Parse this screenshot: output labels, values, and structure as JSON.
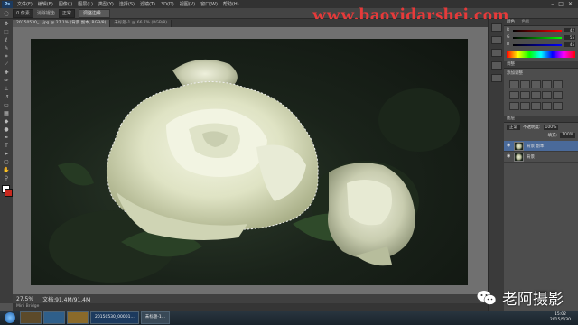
{
  "menubar": {
    "logo": "Ps",
    "items": [
      "文件(F)",
      "编辑(E)",
      "图像(I)",
      "图层(L)",
      "类型(Y)",
      "选择(S)",
      "滤镜(T)",
      "3D(D)",
      "视图(V)",
      "窗口(W)",
      "帮助(H)"
    ]
  },
  "options": {
    "feather_value": "0 像素",
    "anti_alias_label": "消除锯齿",
    "style_value": "正常",
    "refine_edge_label": "调整边缘..."
  },
  "watermark": "www.baoyidarshei.com",
  "document": {
    "tab_active": "20150530_...jpg @ 27.1% (背景 副本, RGB/8)",
    "tab_other": "未标题-1 @ 66.7% (RGB/8)"
  },
  "status": {
    "zoom": "27.5%",
    "doc_size": "文档:91.4M/91.4M",
    "bridge_label": "Mini Bridge"
  },
  "panels": {
    "color_tab": "颜色",
    "swatch_tab": "色板",
    "color_channels": [
      {
        "letter": "R",
        "value": "42"
      },
      {
        "letter": "G",
        "value": "55"
      },
      {
        "letter": "B",
        "value": "45"
      }
    ],
    "adjust_tab": "调整",
    "adjust_hint": "添加调整",
    "layers_tab": "图层",
    "blend_mode": "正常",
    "opacity_label": "不透明度:",
    "opacity": "100%",
    "fill_label": "填充:",
    "fill": "100%",
    "layers": [
      {
        "name": "背景 副本",
        "selected": true
      },
      {
        "name": "背景",
        "selected": false
      }
    ]
  },
  "taskbar": {
    "apps": [
      "",
      "",
      "",
      "20150530_00001...",
      "未标题-1..."
    ],
    "time": "15:02",
    "date": "2015/5/30"
  },
  "wechat_label": "老阿摄影",
  "colors": {
    "watermark": "#e63a3a",
    "background_swatch": "#c8281e",
    "selection": "#4a6a9a"
  }
}
